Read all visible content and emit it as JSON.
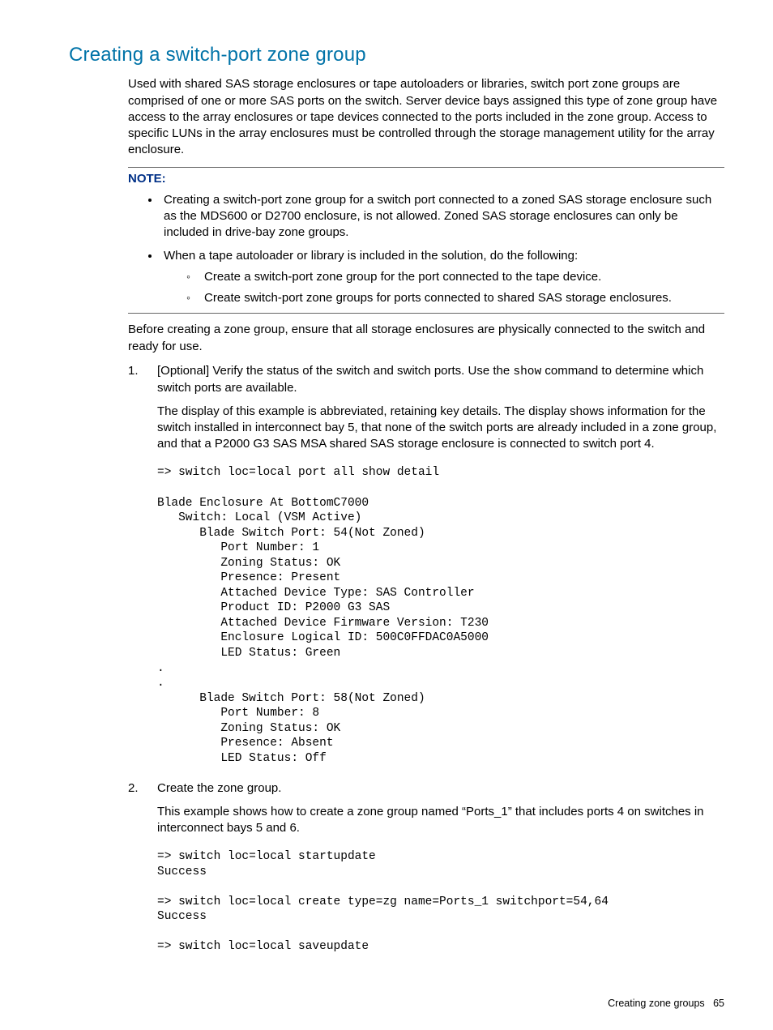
{
  "title": "Creating a switch-port zone group",
  "intro": "Used with shared SAS storage enclosures or tape autoloaders or libraries, switch port zone groups are comprised of one or more SAS ports on the switch. Server device bays assigned this type of zone group have access to the array enclosures or tape devices connected to the ports included in the zone group. Access to specific LUNs in the array enclosures must be controlled through the storage management utility for the array enclosure.",
  "note_label": "NOTE:",
  "note": {
    "b1": "Creating a switch-port zone group for a switch port connected to a zoned SAS storage enclosure such as the MDS600 or D2700 enclosure, is not allowed. Zoned SAS storage enclosures can only be included in drive-bay zone groups.",
    "b2": "When a tape autoloader or library is included in the solution, do the following:",
    "b2a": "Create a switch-port zone group for the port connected to the tape device.",
    "b2b": "Create switch-port zone groups for ports connected to shared SAS storage enclosures."
  },
  "before": "Before creating a zone group, ensure that all storage enclosures are physically connected to the switch and ready for use.",
  "steps": {
    "s1": {
      "num": "1.",
      "p1a": "[Optional] Verify the status of the switch and switch ports. Use the ",
      "cmd": "show",
      "p1b": " command to determine which switch ports are available.",
      "p2": "The display of this example is abbreviated, retaining key details. The display shows information for the switch installed in interconnect bay 5, that none of the switch ports are already included in a zone group, and that a P2000 G3 SAS MSA shared SAS storage enclosure is connected to switch port 4.",
      "code": "=> switch loc=local port all show detail\n\nBlade Enclosure At BottomC7000\n   Switch: Local (VSM Active)\n      Blade Switch Port: 54(Not Zoned)\n         Port Number: 1\n         Zoning Status: OK\n         Presence: Present\n         Attached Device Type: SAS Controller\n         Product ID: P2000 G3 SAS\n         Attached Device Firmware Version: T230\n         Enclosure Logical ID: 500C0FFDAC0A5000\n         LED Status: Green\n.\n.\n      Blade Switch Port: 58(Not Zoned)\n         Port Number: 8\n         Zoning Status: OK\n         Presence: Absent\n         LED Status: Off"
    },
    "s2": {
      "num": "2.",
      "p1": "Create the zone group.",
      "p2": "This example shows how to create a zone group named “Ports_1” that includes ports 4 on switches in interconnect bays 5 and 6.",
      "code": "=> switch loc=local startupdate\nSuccess\n\n=> switch loc=local create type=zg name=Ports_1 switchport=54,64\nSuccess\n\n=> switch loc=local saveupdate"
    }
  },
  "footer": {
    "section": "Creating zone groups",
    "page": "65"
  }
}
